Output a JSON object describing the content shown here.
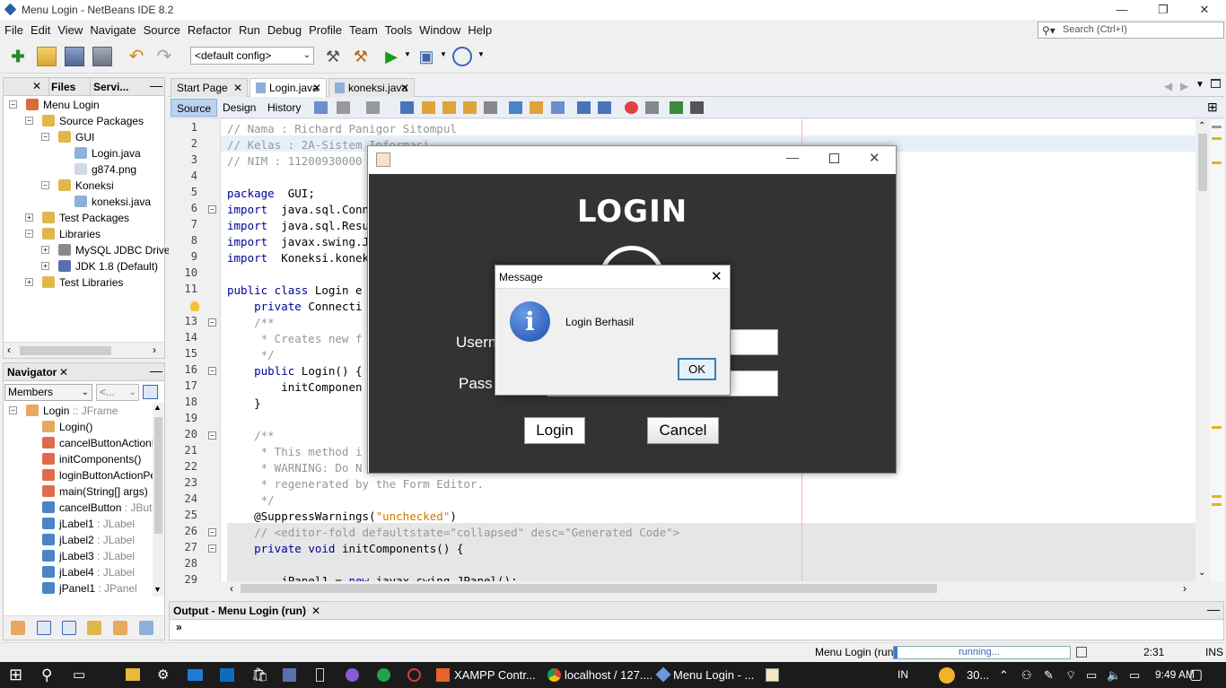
{
  "window": {
    "title": "Menu Login - NetBeans IDE 8.2"
  },
  "menu": [
    "File",
    "Edit",
    "View",
    "Navigate",
    "Source",
    "Refactor",
    "Run",
    "Debug",
    "Profile",
    "Team",
    "Tools",
    "Window",
    "Help"
  ],
  "search": {
    "placeholder": "Search (Ctrl+I)"
  },
  "toolbar": {
    "config": "<default config>"
  },
  "projects_pane": {
    "tabs": [
      "Files",
      "Servi..."
    ]
  },
  "project_tree": [
    {
      "label": "Menu Login",
      "level": 0,
      "icon": "project-icon",
      "sign": "−"
    },
    {
      "label": "Source Packages",
      "level": 1,
      "icon": "source-packages-icon",
      "sign": "−"
    },
    {
      "label": "GUI",
      "level": 2,
      "icon": "package-icon",
      "sign": "−"
    },
    {
      "label": "Login.java",
      "level": 3,
      "icon": "java-file-icon",
      "sign": ""
    },
    {
      "label": "g874.png",
      "level": 3,
      "icon": "image-file-icon",
      "sign": ""
    },
    {
      "label": "Koneksi",
      "level": 2,
      "icon": "package-icon",
      "sign": "−"
    },
    {
      "label": "koneksi.java",
      "level": 3,
      "icon": "java-file-icon",
      "sign": ""
    },
    {
      "label": "Test Packages",
      "level": 1,
      "icon": "test-packages-icon",
      "sign": "+"
    },
    {
      "label": "Libraries",
      "level": 1,
      "icon": "libraries-icon",
      "sign": "−"
    },
    {
      "label": "MySQL JDBC Driver",
      "level": 2,
      "icon": "jar-icon",
      "sign": "+"
    },
    {
      "label": "JDK 1.8 (Default)",
      "level": 2,
      "icon": "jdk-icon",
      "sign": "+"
    },
    {
      "label": "Test Libraries",
      "level": 1,
      "icon": "test-libraries-icon",
      "sign": "+"
    }
  ],
  "navigator": {
    "title": "Navigator",
    "filter": "Members",
    "filter2": "<...",
    "items": [
      {
        "name": "Login",
        "type": " :: JFrame",
        "level": 0,
        "icon": "class-icon",
        "sign": "−"
      },
      {
        "name": "Login()",
        "type": "",
        "level": 1,
        "icon": "constructor-icon",
        "sign": ""
      },
      {
        "name": "cancelButtonActionPe",
        "type": "",
        "level": 1,
        "icon": "method-icon",
        "sign": ""
      },
      {
        "name": "initComponents()",
        "type": "",
        "level": 1,
        "icon": "method-icon",
        "sign": ""
      },
      {
        "name": "loginButtonActionPer",
        "type": "",
        "level": 1,
        "icon": "method-icon",
        "sign": ""
      },
      {
        "name": "main(String[] args)",
        "type": "",
        "level": 1,
        "icon": "static-method-icon",
        "sign": ""
      },
      {
        "name": "cancelButton",
        "type": " : JButto",
        "level": 1,
        "icon": "field-icon",
        "sign": ""
      },
      {
        "name": "jLabel1",
        "type": " : JLabel",
        "level": 1,
        "icon": "field-icon",
        "sign": ""
      },
      {
        "name": "jLabel2",
        "type": " : JLabel",
        "level": 1,
        "icon": "field-icon",
        "sign": ""
      },
      {
        "name": "jLabel3",
        "type": " : JLabel",
        "level": 1,
        "icon": "field-icon",
        "sign": ""
      },
      {
        "name": "jLabel4",
        "type": " : JLabel",
        "level": 1,
        "icon": "field-icon",
        "sign": ""
      },
      {
        "name": "jPanel1",
        "type": " : JPanel",
        "level": 1,
        "icon": "field-icon",
        "sign": ""
      }
    ]
  },
  "editor": {
    "tabs": [
      {
        "label": "Start Page",
        "active": false
      },
      {
        "label": "Login.java",
        "active": true
      },
      {
        "label": "koneksi.java",
        "active": false
      }
    ],
    "view_tabs": [
      "Source",
      "Design",
      "History"
    ],
    "lines": [
      {
        "n": "1",
        "c": [
          [
            "cm",
            "// Nama : Richard Panigor Sitompul"
          ]
        ]
      },
      {
        "n": "2",
        "c": [
          [
            "cm",
            "// Kelas : 2A-Sistem Informasi"
          ]
        ]
      },
      {
        "n": "3",
        "c": [
          [
            "cm",
            "// NIM : 11200930000"
          ]
        ]
      },
      {
        "n": "4",
        "c": []
      },
      {
        "n": "5",
        "c": [
          [
            "kw",
            "package"
          ],
          [
            "",
            "  GUI;"
          ]
        ]
      },
      {
        "n": "6",
        "c": [
          [
            "kw",
            "import"
          ],
          [
            "",
            "  java.sql.Conn"
          ]
        ]
      },
      {
        "n": "7",
        "c": [
          [
            "kw",
            "import"
          ],
          [
            "",
            "  java.sql.Resu"
          ]
        ]
      },
      {
        "n": "8",
        "c": [
          [
            "kw",
            "import"
          ],
          [
            "",
            "  javax.swing.J"
          ]
        ]
      },
      {
        "n": "9",
        "c": [
          [
            "kw",
            "import"
          ],
          [
            "",
            "  Koneksi.konek"
          ]
        ]
      },
      {
        "n": "10",
        "c": []
      },
      {
        "n": "11",
        "c": [
          [
            "kw",
            "public class"
          ],
          [
            "",
            " Login e"
          ]
        ]
      },
      {
        "n": "",
        "c": [
          [
            "",
            "    "
          ],
          [
            "kw",
            "private"
          ],
          [
            "",
            " Connecti"
          ]
        ]
      },
      {
        "n": "13",
        "c": [
          [
            "cm",
            "    /**"
          ]
        ]
      },
      {
        "n": "14",
        "c": [
          [
            "cm",
            "     * Creates new f"
          ]
        ]
      },
      {
        "n": "15",
        "c": [
          [
            "cm",
            "     */"
          ]
        ]
      },
      {
        "n": "16",
        "c": [
          [
            "",
            "    "
          ],
          [
            "kw",
            "public"
          ],
          [
            "",
            " Login() {"
          ]
        ]
      },
      {
        "n": "17",
        "c": [
          [
            "",
            "        initComponen"
          ]
        ]
      },
      {
        "n": "18",
        "c": [
          [
            "",
            "    }"
          ]
        ]
      },
      {
        "n": "19",
        "c": []
      },
      {
        "n": "20",
        "c": [
          [
            "cm",
            "    /**"
          ]
        ]
      },
      {
        "n": "21",
        "c": [
          [
            "cm",
            "     * This method i"
          ]
        ]
      },
      {
        "n": "22",
        "c": [
          [
            "cm",
            "     * WARNING: Do N"
          ]
        ]
      },
      {
        "n": "23",
        "c": [
          [
            "cm",
            "     * regenerated by the Form Editor."
          ]
        ]
      },
      {
        "n": "24",
        "c": [
          [
            "cm",
            "     */"
          ]
        ]
      },
      {
        "n": "25",
        "c": [
          [
            "",
            "    @SuppressWarnings("
          ],
          [
            "str",
            "\"unchecked\""
          ],
          [
            "",
            ")"
          ]
        ]
      },
      {
        "n": "26",
        "c": [
          [
            "cm",
            "    // <editor-fold defaultstate=\"collapsed\" desc=\"Generated Code\">"
          ]
        ]
      },
      {
        "n": "27",
        "c": [
          [
            "",
            "    "
          ],
          [
            "kw",
            "private void"
          ],
          [
            "",
            " initComponents() {"
          ]
        ]
      },
      {
        "n": "28",
        "c": []
      },
      {
        "n": "29",
        "c": [
          [
            "",
            "        jPanel1 = "
          ],
          [
            "kw",
            "new"
          ],
          [
            "",
            " javax.swing.JPanel();"
          ]
        ]
      }
    ]
  },
  "output": {
    "title": "Output - Menu Login (run)",
    "prompt": "»"
  },
  "status": {
    "project": "Menu Login (run)",
    "progress": "running...",
    "position": "2:31",
    "mode": "INS"
  },
  "login_window": {
    "title": "LOGIN",
    "username_label": "Usern",
    "password_label": "Pass",
    "login_button": "Login",
    "cancel_button": "Cancel"
  },
  "dialog": {
    "title": "Message",
    "message": "Login Berhasil",
    "ok": "OK"
  },
  "taskbar": {
    "xampp": "XAMPP Contr...",
    "chrome": "localhost / 127....",
    "netbeans": "Menu Login - ...",
    "lang": "IN",
    "weather": "30...",
    "time": "9:49 AM"
  }
}
